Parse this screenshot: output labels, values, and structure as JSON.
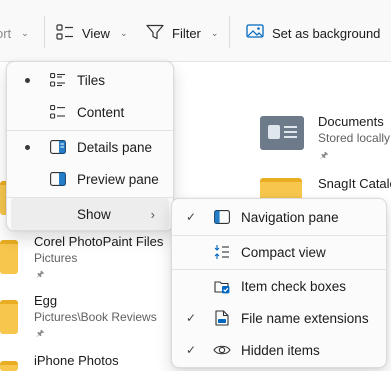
{
  "toolbar": {
    "sort_label": "ort",
    "view_label": "View",
    "filter_label": "Filter",
    "set_bg_label": "Set as background"
  },
  "files": [
    {
      "name": "Documents",
      "sub": "Stored locally"
    },
    {
      "name": "SnagIt Catalog",
      "sub": ""
    },
    {
      "name": "Corel PhotoPaint Files",
      "sub": "Pictures"
    },
    {
      "name": "Egg",
      "sub": "Pictures\\Book Reviews"
    },
    {
      "name": "iPhone Photos",
      "sub": ""
    }
  ],
  "view_menu": {
    "items": [
      {
        "label": "Tiles",
        "icon": "tiles-icon",
        "selected": true
      },
      {
        "label": "Content",
        "icon": "content-icon",
        "selected": false
      },
      {
        "label": "Details pane",
        "icon": "details-pane-icon",
        "selected": true
      },
      {
        "label": "Preview pane",
        "icon": "preview-pane-icon",
        "selected": false
      },
      {
        "label": "Show",
        "icon": "",
        "submenu": true
      }
    ]
  },
  "show_menu": {
    "items": [
      {
        "label": "Navigation pane",
        "icon": "navigation-pane-icon",
        "checked": true
      },
      {
        "label": "Compact view",
        "icon": "compact-view-icon",
        "checked": false
      },
      {
        "label": "Item check boxes",
        "icon": "item-check-boxes-icon",
        "checked": false
      },
      {
        "label": "File name extensions",
        "icon": "file-extensions-icon",
        "checked": true
      },
      {
        "label": "Hidden items",
        "icon": "hidden-items-icon",
        "checked": true
      }
    ]
  },
  "colors": {
    "accent": "#0067c0",
    "folder": "#f6c64d"
  }
}
